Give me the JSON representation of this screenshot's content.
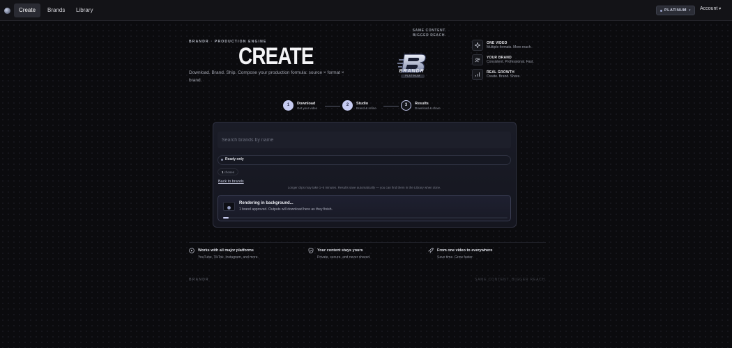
{
  "nav": {
    "items": [
      {
        "label": "Create",
        "active": true
      },
      {
        "label": "Brands",
        "active": false
      },
      {
        "label": "Library",
        "active": false
      }
    ],
    "plan_badge": "PLATINUM",
    "plan_caret": "▾",
    "account_label": "Account",
    "account_caret": "▾"
  },
  "hero": {
    "eyebrow": "BRANDR · PRODUCTION ENGINE",
    "title": "CREATE",
    "subtitle": "Download. Brand. Ship. Compose your production formula: source × format × brand.",
    "tagline_line1": "SAME CONTENT.",
    "tagline_line2": "BIGGER REACH.",
    "logo_word": "BRANDR",
    "logo_tier": "PLATINUM"
  },
  "features": [
    {
      "icon": "sparkle-icon",
      "title": "ONE VIDEO",
      "desc": "Multiple formats. More reach."
    },
    {
      "icon": "users-icon",
      "title": "YOUR BRAND",
      "desc": "Consistent. Professional. Fast."
    },
    {
      "icon": "bar-chart-icon",
      "title": "REAL GROWTH",
      "desc": "Create. Brand. Share."
    }
  ],
  "stepper": {
    "steps": [
      {
        "num": "1",
        "label": "Download",
        "sub": "Get your video"
      },
      {
        "num": "2",
        "label": "Studio",
        "sub": "Brand & refine"
      },
      {
        "num": "3",
        "label": "Results",
        "sub": "Download & share"
      }
    ],
    "current": 3
  },
  "panel": {
    "search_placeholder": "Search brands by name",
    "filter_label": "Ready only",
    "count_value": "1",
    "count_label": "chosen",
    "back_link": "Back to brands",
    "note": "Longer clips may take 1–5 minutes. Results save automatically — you can find them in the Library when done.",
    "render": {
      "title": "Rendering in background...",
      "subtitle": "1 brand approved. Outputs will download here as they finish.",
      "progress": 0.02
    }
  },
  "bottom_features": [
    {
      "icon": "play-circle-icon",
      "title": "Works with all major platforms",
      "desc": "YouTube, TikTok, Instagram, and more."
    },
    {
      "icon": "shield-check-icon",
      "title": "Your content stays yours",
      "desc": "Private, secure, and never shared."
    },
    {
      "icon": "rocket-icon",
      "title": "From one video to everywhere",
      "desc": "Save time. Grow faster."
    }
  ],
  "footer": {
    "left": "BRANDR",
    "right": "SAME CONTENT. BIGGER REACH."
  },
  "colors": {
    "background": "#0b0b0e",
    "accent": "#c7ccf2",
    "panel": "#1a1c27"
  }
}
